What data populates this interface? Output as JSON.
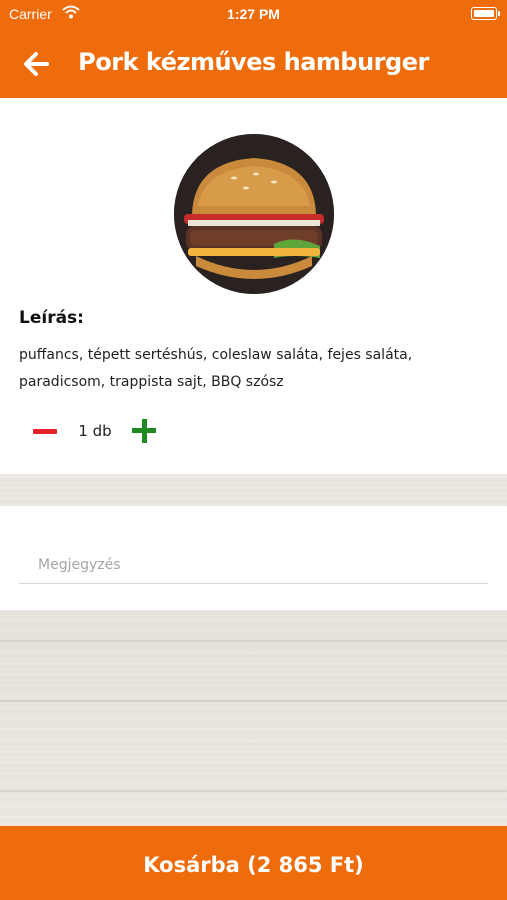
{
  "status_bar": {
    "carrier": "Carrier",
    "time": "1:27 PM",
    "wifi_icon": "wifi-icon",
    "battery_icon": "battery-icon"
  },
  "nav": {
    "title": "Pork kézműves hamburger",
    "back_icon": "back-arrow-icon"
  },
  "product": {
    "image_icon": "burger-photo",
    "description_label": "Leírás:",
    "description": "puffancs, tépett sertéshús, coleslaw saláta, fejes saláta, paradicsom, trappista sajt, BBQ szósz"
  },
  "quantity": {
    "value": "1 db",
    "minus_icon": "minus-icon",
    "plus_icon": "plus-icon"
  },
  "note": {
    "placeholder": "Megjegyzés",
    "value": ""
  },
  "cart": {
    "label": "Kosárba (2 865 Ft)"
  },
  "colors": {
    "accent": "#ee6c0c",
    "minus": "#e3232a",
    "plus": "#1f8a22",
    "background": "#f1ece7"
  }
}
